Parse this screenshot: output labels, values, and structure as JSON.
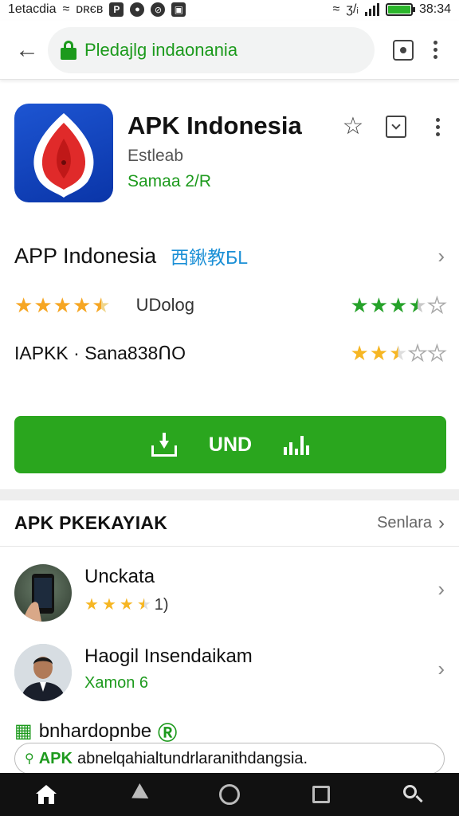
{
  "status_bar": {
    "left_text": "1etаcdia",
    "carrier": "ᴅʀєв",
    "time": "38:34",
    "network": "ʒ/ᵢ",
    "battery_percent": 100
  },
  "browser": {
    "url": "Pledajlg indaonania"
  },
  "app": {
    "title": "APK Indonesia",
    "developer": "Estleab",
    "subtitle": "Samaa 2/R"
  },
  "rows": {
    "row1_title": "APP Indonesia",
    "row1_badge": "西鍬教БL",
    "row2_label": "UDolog",
    "row2_left_rating": 4.5,
    "row2_right_rating": 3.5,
    "row3_label": "IAPKK · Sana838ՈO",
    "row3_right_rating": 2.5
  },
  "install": {
    "label": "UND"
  },
  "section": {
    "title": "APK PKEKAYIAK",
    "more": "Senlara"
  },
  "list": [
    {
      "title": "Unckata",
      "sub": "1)",
      "rating": 3.5
    },
    {
      "title": "Haogil Insendaikam",
      "sub": "Xamon 6"
    }
  ],
  "bottom": {
    "heading": "bnhardopnbe",
    "search_prefix": "APK",
    "search_text": "abnelqahialtundrlaranithdangsia."
  },
  "icons": {
    "back": "arrow-left-icon",
    "lock": "lock-icon",
    "tabs": "tab-switch-icon",
    "menu": "more-vert-icon",
    "star": "star-icon",
    "bookmark": "bookmark-icon",
    "chevron": "chevron-right-icon",
    "download": "download-icon",
    "home": "home-icon",
    "search": "search-icon"
  },
  "colors": {
    "accent_green": "#2aa61e",
    "link_blue": "#1a8fd6",
    "star_gold": "#f6a623",
    "star_green": "#26a22a"
  }
}
